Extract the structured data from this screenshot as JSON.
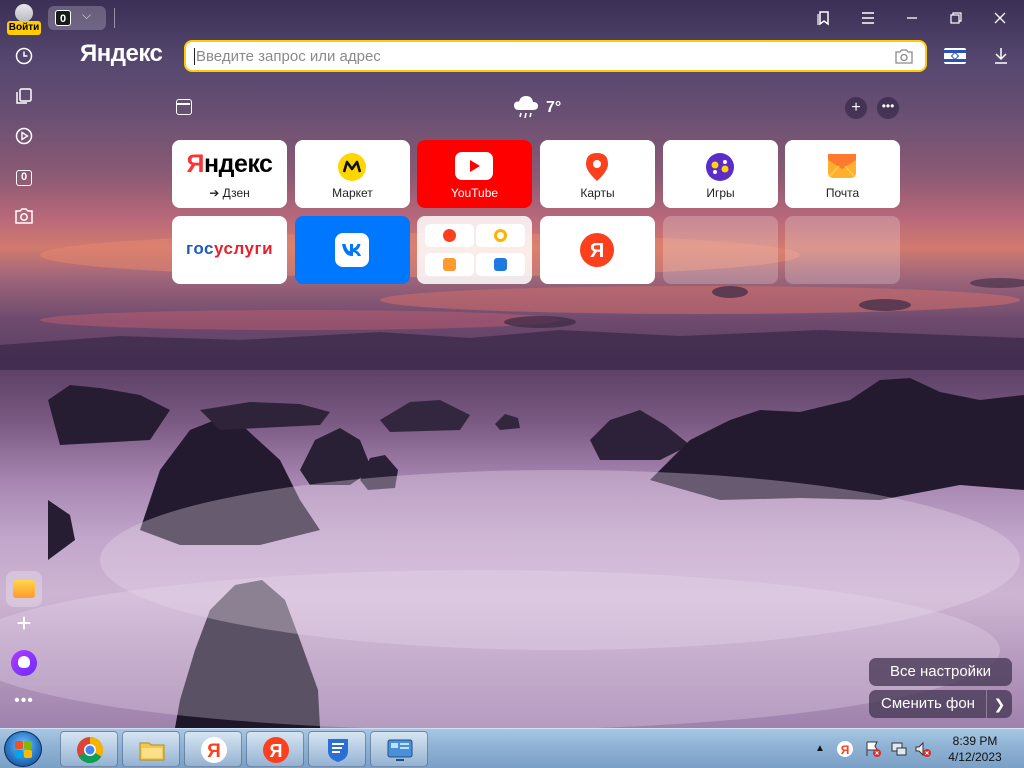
{
  "titlebar": {
    "login_label": "Войти",
    "tab_count": "0"
  },
  "sidebar": {
    "counter": "0"
  },
  "omnibox": {
    "brand": "Яндекс",
    "placeholder": "Введите запрос или адрес"
  },
  "weather": {
    "temperature": "7°"
  },
  "tiles": [
    {
      "caption": "➔ Дзен",
      "logo": "Яндекс"
    },
    {
      "caption": "Маркет"
    },
    {
      "caption": "YouTube"
    },
    {
      "caption": "Карты"
    },
    {
      "caption": "Игры"
    },
    {
      "caption": "Почта"
    },
    {
      "logo_part1": "гос",
      "logo_part2": "услуги"
    },
    {
      "logo": "VK"
    },
    {
      "group": true
    },
    {
      "logo": "Я"
    },
    {
      "empty": true
    },
    {
      "empty": true
    }
  ],
  "buttons": {
    "all_settings": "Все настройки",
    "change_bg": "Сменить фон"
  },
  "taskbar": {
    "time": "8:39 PM",
    "date": "4/12/2023",
    "yandex_letter": "Я"
  },
  "colors": {
    "accent": "#ffcc00",
    "youtube": "#ff0000",
    "vk": "#0077ff",
    "yandex_red": "#fc3f1d"
  }
}
